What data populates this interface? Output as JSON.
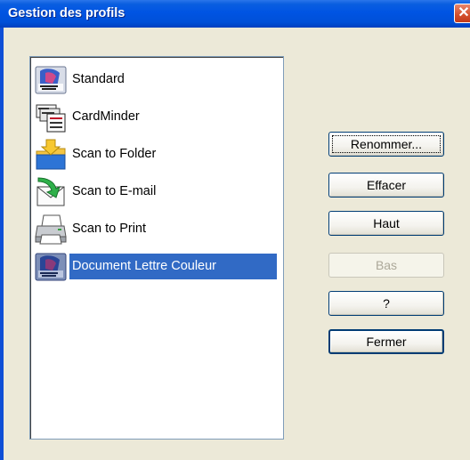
{
  "window": {
    "title": "Gestion des profils",
    "close_glyph": "✕"
  },
  "profiles": [
    {
      "label": "Standard",
      "icon": "scanner-organizer-icon",
      "selected": false
    },
    {
      "label": "CardMinder",
      "icon": "card-scanner-icon",
      "selected": false
    },
    {
      "label": "Scan to Folder",
      "icon": "folder-arrow-icon",
      "selected": false
    },
    {
      "label": "Scan to E-mail",
      "icon": "envelope-arrow-icon",
      "selected": false
    },
    {
      "label": "Scan to Print",
      "icon": "printer-icon",
      "selected": false
    },
    {
      "label": "Document Lettre Couleur",
      "icon": "scanner-organizer-icon",
      "selected": true
    }
  ],
  "buttons": {
    "rename": "Renommer...",
    "delete": "Effacer",
    "up": "Haut",
    "down": "Bas",
    "help": "?",
    "close": "Fermer"
  },
  "colors": {
    "titlebar": "#0054e3",
    "selection": "#316ac5",
    "dialog_bg": "#ece9d8"
  }
}
